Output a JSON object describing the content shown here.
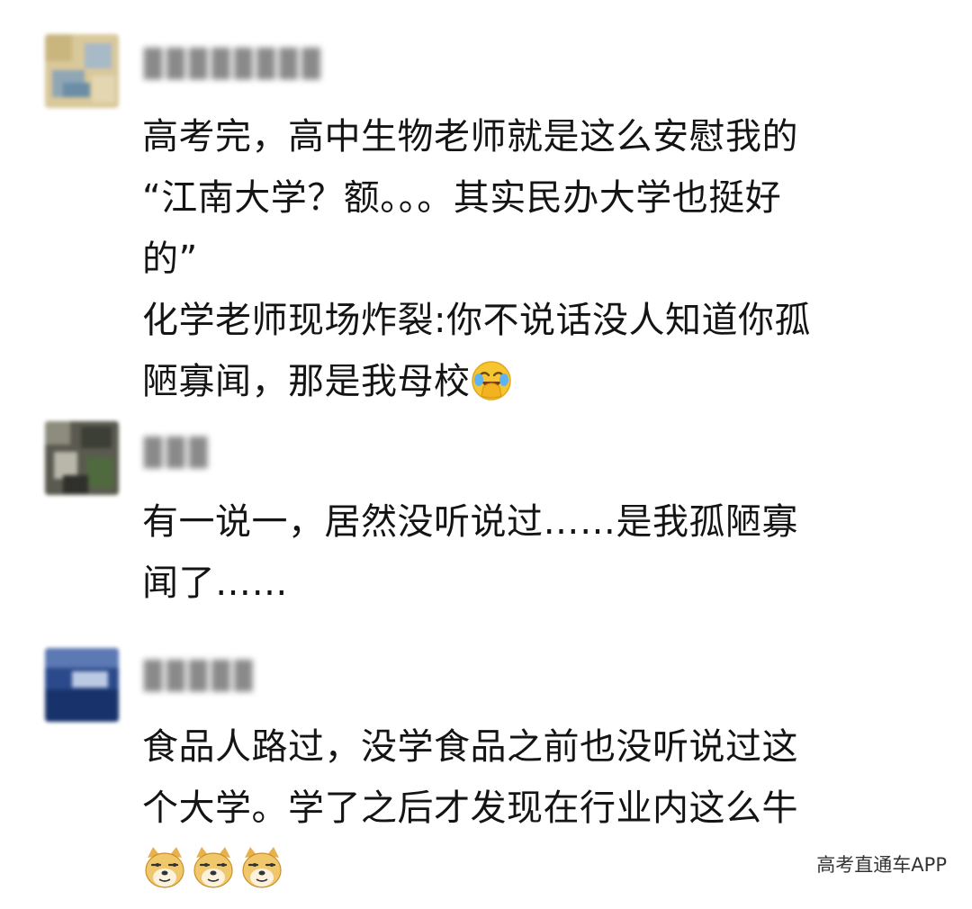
{
  "comments": [
    {
      "username": "▉▉▉▉▉▉▉▉",
      "lines": [
        "高考完，高中生物老师就是这么安慰我的",
        "“江南大学？额。。。其实民办大学也挺好",
        "的”",
        "化学老师现场炸裂:你不说话没人知道你孤",
        "陋寡闻，那是我母校"
      ],
      "emoji": "crying-laughing-face"
    },
    {
      "username": "▉▉▉",
      "lines": [
        "有一说一，居然没听说过……是我孤陋寡",
        "闻了……"
      ]
    },
    {
      "username": "▉▉▉▉▉",
      "lines": [
        "食品人路过，没学食品之前也没听说过这",
        "个大学。学了之后才发现在行业内这么牛"
      ],
      "emoji": "doge-face",
      "emoji_count": 3
    }
  ],
  "watermark": "高考直通车APP",
  "colors": {
    "background": "#ffffff",
    "text": "#141414",
    "username_blur": "#8a8a8a",
    "watermark": "#333333"
  }
}
